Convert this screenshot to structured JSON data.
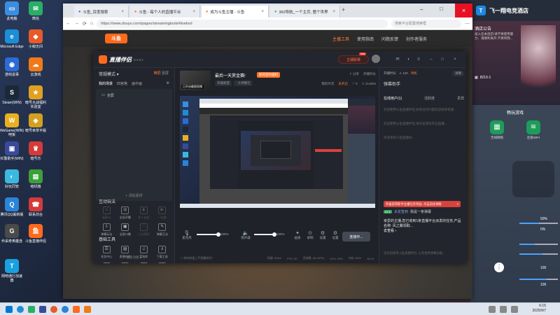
{
  "desktop": {
    "icons": [
      {
        "label": "此电脑",
        "color": "#3b8de0",
        "glyph": "▭"
      },
      {
        "label": "微信",
        "color": "#2aae67",
        "glyph": "✉"
      },
      {
        "label": "Microsoft Edge",
        "color": "#1c8ed6",
        "glyph": "e"
      },
      {
        "label": "小萌无间",
        "color": "#e85a2a",
        "glyph": "◆"
      },
      {
        "label": "游戏说事",
        "color": "#2c6bd4",
        "glyph": "◉"
      },
      {
        "label": "云游戏",
        "color": "#f07a1a",
        "glyph": "☁"
      },
      {
        "label": "Steam(WIN)",
        "color": "#1b2838",
        "glyph": "S"
      },
      {
        "label": "暗号大战福利实验室",
        "color": "#e0a020",
        "glyph": "★"
      },
      {
        "label": "WeGame(WIN)吧板",
        "color": "#e8b020",
        "glyph": "W"
      },
      {
        "label": "暗号幸草平版",
        "color": "#d4a020",
        "glyph": "◈"
      },
      {
        "label": "红警助手(WIN)",
        "color": "#3a4a9a",
        "glyph": "▣"
      },
      {
        "label": "暗号乐",
        "color": "#d43a3a",
        "glyph": "♛"
      },
      {
        "label": "好玩同管",
        "color": "#3cb8e0",
        "glyph": "◐"
      },
      {
        "label": "暗机箱",
        "color": "#3aa03a",
        "glyph": "▤"
      },
      {
        "label": "腾讯QQ最新版",
        "color": "#2a84d8",
        "glyph": "Q"
      },
      {
        "label": "联系前台",
        "color": "#d43a3a",
        "glyph": "☎"
      },
      {
        "label": "乔采奇英雄连",
        "color": "#4a4a4a",
        "glyph": "G"
      },
      {
        "label": "斗鱼直播伴侣",
        "color": "#ff6b1c",
        "glyph": "鱼"
      },
      {
        "label": "网吧通行加速器",
        "color": "#18a0e0",
        "glyph": "T"
      }
    ]
  },
  "right_widget": {
    "title": "飞一翔电竞酒店",
    "notice": "酒店公告",
    "notice_text": "加入任本酒店!请不要使用暴力、请顺利离开,不要将我...",
    "room": "8216-1",
    "section": "畅玩游戏",
    "apps": [
      "无线网络",
      "连接WIFI"
    ],
    "volumes": [
      "50%",
      "0%",
      "100",
      "100"
    ]
  },
  "browser": {
    "tabs": [
      {
        "label": "斗鱼_百度搜索",
        "active": false
      },
      {
        "label": "斗鱼 - 每个人的直播平台",
        "active": false
      },
      {
        "label": "成为斗鱼主播 - 斗鱼",
        "active": true
      },
      {
        "label": "360导航_一个主页, 整个世界",
        "active": false
      }
    ],
    "url": "https://www.douyu.com/pages/streamingtools#livetool",
    "search_placeholder": "搜索平台配置搜索框",
    "nav": {
      "logo": "斗鱼",
      "links": [
        "主播工具",
        "使用指南",
        "问题反馈",
        "创作者服务"
      ],
      "active_index": 0
    }
  },
  "app": {
    "brand": "直播伴侣",
    "version": "6.4.9.1",
    "live_button": "主播联赛",
    "live_badge": "new",
    "mode_label": "常规模式 ▾",
    "mode_tabs": [
      "横屏",
      "竖屏"
    ],
    "scene_tabs": [
      "我的场景",
      "四宫格",
      "画中画"
    ],
    "scene_item": "全屏",
    "add_material": "+ 添加素材",
    "interaction_title": "互动玩法",
    "interaction_tools": [
      {
        "label": "连麦PK",
        "dim": true
      },
      {
        "label": "全局开播",
        "dim": false
      },
      {
        "label": "多人连麦",
        "dim": true
      },
      {
        "label": "一起看",
        "dim": true
      },
      {
        "label": "弹幕玩法",
        "dim": false
      },
      {
        "label": "全屏口播",
        "dim": false
      },
      {
        "label": "心动视频",
        "dim": true
      },
      {
        "label": "弹幕互动",
        "dim": false
      }
    ],
    "basic_title": "基础工具",
    "basic_tools": [
      {
        "label": "任务中心",
        "dim": false
      },
      {
        "label": "直播任务",
        "dim": false
      },
      {
        "label": "音效库",
        "dim": false
      },
      {
        "label": "下载工具",
        "dim": false
      },
      {
        "label": "弹幕墙",
        "dim": false
      },
      {
        "label": "房管助手",
        "dim": false
      },
      {
        "label": "准备设备",
        "dim": false
      },
      {
        "label": "下播回看",
        "dim": false
      }
    ],
    "more_label": "更多功能 ▸",
    "room_title": "最后一天赏金赛!",
    "room_tag": "新的签约福利",
    "cover_label": "已开启截图直播",
    "room_meta": [
      "英雄联盟",
      "· 大神都在"
    ],
    "room_right": [
      "分享",
      "开播时长"
    ],
    "room_stats": [
      "我的声音",
      "未开启",
      "0",
      "213804"
    ],
    "mic_label": "麦克风",
    "mic_value": "100%",
    "speaker_label": "扬声器",
    "speaker_value": "100%",
    "ctrl_icons": [
      "画质",
      "录制",
      "设置",
      "设置"
    ],
    "go_live": "连接中...",
    "status": [
      "如何快速上手直播伴侣?",
      "网速: 0Kb/s",
      "FPS: 30",
      "丢帧数: 0(0.00%)",
      "CPU: 25%",
      "内存: 80%",
      "18:13"
    ],
    "right": {
      "top": [
        "开播时长",
        "120",
        "待机",
        "详情"
      ],
      "head": "弹幕助手",
      "tabs": [
        "在线用户(1)",
        "活跃度",
        "贵宾"
      ],
      "chat1": "欢迎使用斗鱼直播伴侣,如有任何问题欢迎联系客服...",
      "chat2": "欢迎使用斗鱼直播伴侣,请点击预览开启直播...",
      "chat3": "欢迎来到斗鱼直播间...",
      "red": "恭喜获得新手主播任务奖励, 点击前往领取",
      "user": "水友签到",
      "user_msg": "我是一条弹幕",
      "level": "LV 1",
      "tip": "亲爱的主播,您已收到1条直播平台派发的任务,产品名称: 风之翼领取...",
      "tip_link": "去查看 ›",
      "foot": "欢迎您使用斗鱼直播伴侣, 以及使用弹幕功能..."
    }
  },
  "taskbar": {
    "time": "6:15",
    "date": "2025/9/7"
  }
}
